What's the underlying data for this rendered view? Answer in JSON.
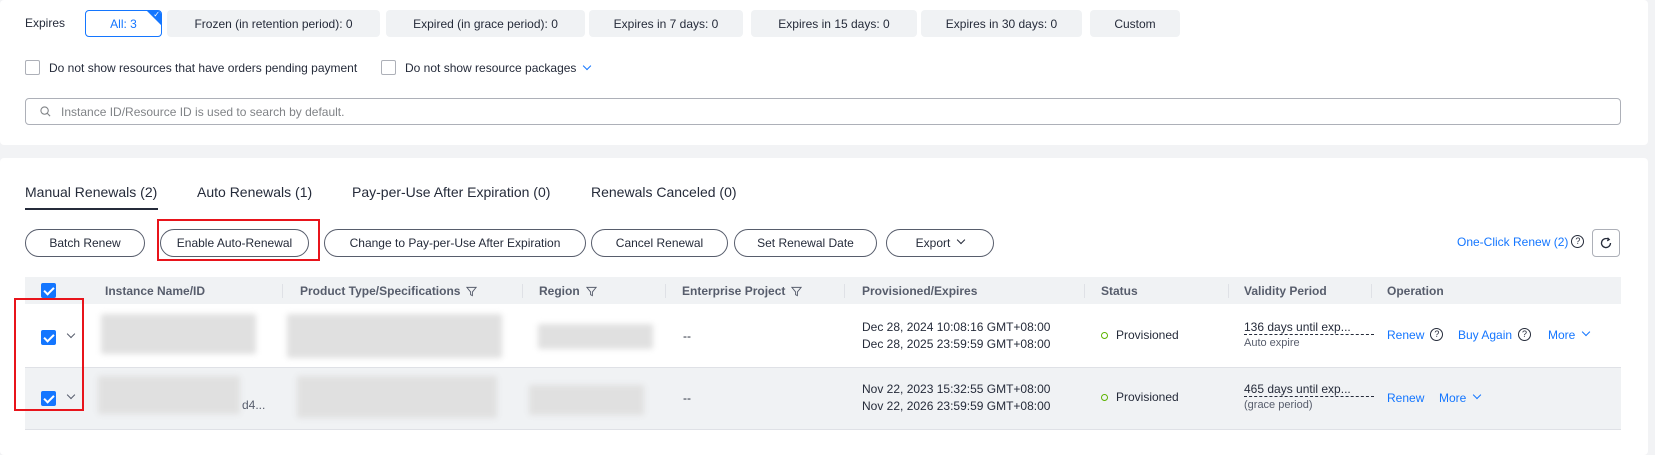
{
  "filters": {
    "expires_label": "Expires",
    "chips": [
      {
        "label": "All: 3"
      },
      {
        "label": "Frozen (in retention period): 0"
      },
      {
        "label": "Expired (in grace period): 0"
      },
      {
        "label": "Expires in 7 days: 0"
      },
      {
        "label": "Expires in 15 days: 0"
      },
      {
        "label": "Expires in 30 days: 0"
      },
      {
        "label": "Custom"
      }
    ],
    "checkbox_pending": "Do not show resources that have orders pending payment",
    "checkbox_packages": "Do not show resource packages"
  },
  "search": {
    "placeholder": "Instance ID/Resource ID is used to search by default."
  },
  "tabs": [
    {
      "label": "Manual Renewals (2)"
    },
    {
      "label": "Auto Renewals (1)"
    },
    {
      "label": "Pay-per-Use After Expiration (0)"
    },
    {
      "label": "Renewals Canceled (0)"
    }
  ],
  "actions": {
    "batch_renew": "Batch Renew",
    "enable_auto_renewal": "Enable Auto-Renewal",
    "change_to_ppu": "Change to Pay-per-Use After Expiration",
    "cancel_renewal": "Cancel Renewal",
    "set_renewal_date": "Set Renewal Date",
    "export": "Export",
    "one_click_renew": "One-Click Renew (2)"
  },
  "table": {
    "headers": {
      "instance": "Instance Name/ID",
      "product": "Product Type/Specifications",
      "region": "Region",
      "enterprise": "Enterprise Project",
      "provisioned": "Provisioned/Expires",
      "status": "Status",
      "validity": "Validity Period",
      "operation": "Operation"
    },
    "rows": [
      {
        "instance_suffix": "",
        "enterprise": "--",
        "provisioned": "Dec 28, 2024 10:08:16 GMT+08:00",
        "expires": "Dec 28, 2025 23:59:59 GMT+08:00",
        "status": "Provisioned",
        "validity": "136 days until exp...",
        "validity_sub": "Auto expire",
        "op_renew": "Renew",
        "op_buy_again": "Buy Again",
        "op_more": "More"
      },
      {
        "instance_suffix": "d4...",
        "enterprise": "--",
        "provisioned": "Nov 22, 2023 15:32:55 GMT+08:00",
        "expires": "Nov 22, 2026 23:59:59 GMT+08:00",
        "status": "Provisioned",
        "validity": "465 days until exp...",
        "validity_sub": "(grace period)",
        "op_renew": "Renew",
        "op_more": "More"
      }
    ]
  },
  "colors": {
    "accent": "#1476ff",
    "highlight": "#e8141b",
    "success": "#5cb300"
  }
}
